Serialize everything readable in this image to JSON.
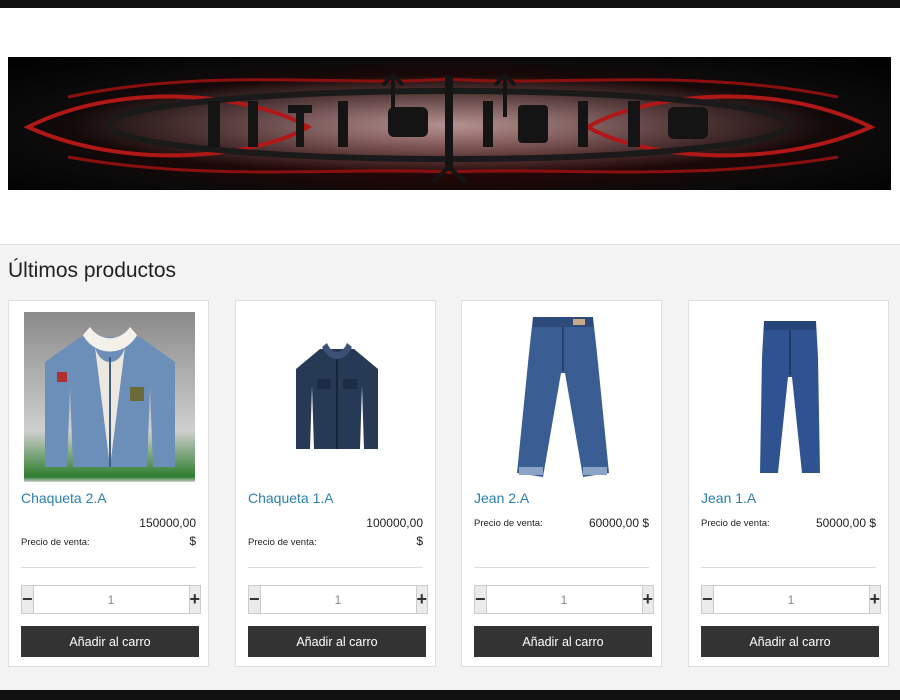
{
  "section_title": "Últimos productos",
  "price_label": "Precio de venta:",
  "currency": "$",
  "add_to_cart_label": "Añadir al carro",
  "products": [
    {
      "name": "Chaqueta 2.A",
      "price": "150000,00",
      "price_display": "150000,00",
      "quantity": "1",
      "layout": "stacked"
    },
    {
      "name": "Chaqueta 1.A",
      "price": "100000,00",
      "price_display": "100000,00",
      "quantity": "1",
      "layout": "stacked"
    },
    {
      "name": "Jean 2.A",
      "price": "60000,00",
      "price_display": "60000,00 $",
      "quantity": "1",
      "layout": "inline"
    },
    {
      "name": "Jean 1.A",
      "price": "50000,00",
      "price_display": "50000,00 $",
      "quantity": "1",
      "layout": "inline"
    }
  ],
  "colors": {
    "accent_link": "#2a7fb0",
    "button_bg": "#333333",
    "section_bg": "#f3f3f3"
  }
}
